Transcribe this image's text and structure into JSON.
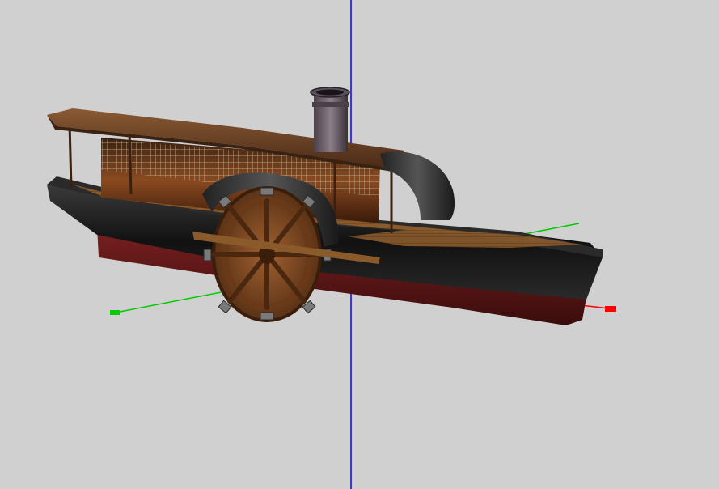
{
  "viewport": {
    "background": "#d0d0d0",
    "axis_colors": {
      "x": "#ff0000",
      "y": "#0000ff",
      "z": "#00cc00"
    }
  },
  "model": {
    "subject": "paddle steamer",
    "colors": {
      "hull_upper": "#1a1a1a",
      "hull_lower": "#5a1515",
      "deck_wood": "#8a5a2b",
      "roof_wood": "#6e4426",
      "cabin_wall": "#6a3a18",
      "funnel": "#6e6470",
      "paddle_wheel": "#8a5228"
    }
  }
}
